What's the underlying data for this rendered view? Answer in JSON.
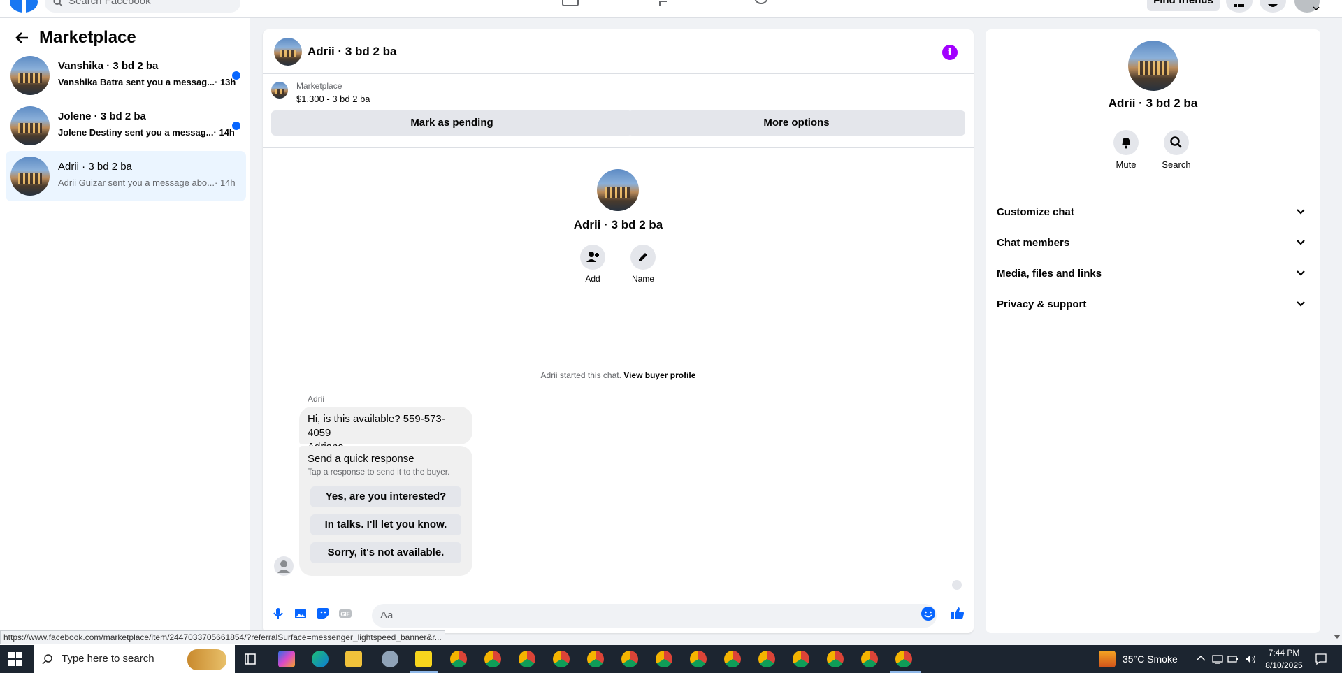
{
  "topbar": {
    "search_placeholder": "Search Facebook",
    "find_friends": "Find friends"
  },
  "sidebar": {
    "title": "Marketplace",
    "conversations": [
      {
        "title": "Vanshika · 3 bd 2 ba",
        "preview": "Vanshika Batra sent you a messag...",
        "time": "· 13h",
        "unread": true
      },
      {
        "title": "Jolene · 3 bd 2 ba",
        "preview": "Jolene Destiny sent you a messag...",
        "time": "· 14h",
        "unread": true
      },
      {
        "title": "Adrii · 3 bd 2 ba",
        "preview": "Adrii Guizar sent you a message abo...",
        "time": "· 14h",
        "unread": false
      }
    ]
  },
  "chat": {
    "header_name": "Adrii · 3 bd 2 ba",
    "listing_source": "Marketplace",
    "listing_price": "$1,300 - 3 bd 2 ba",
    "mark_pending": "Mark as pending",
    "more_options": "More options",
    "profile_name": "Adrii · 3 bd 2 ba",
    "add_label": "Add",
    "name_label": "Name",
    "started_text": "Adrii started this chat.",
    "view_buyer": "View buyer profile",
    "sender": "Adrii",
    "message_line1": "Hi, is this available? 559-573-4059",
    "message_line2": "Adriana",
    "quick_title": "Send a quick response",
    "quick_sub": "Tap a response to send it to the buyer.",
    "quick_responses": [
      "Yes, are you interested?",
      "In talks. I'll let you know.",
      "Sorry, it's not available."
    ],
    "input_placeholder": "Aa"
  },
  "right_panel": {
    "name": "Adrii · 3 bd 2 ba",
    "mute": "Mute",
    "search": "Search",
    "sections": [
      "Customize chat",
      "Chat members",
      "Media, files and links",
      "Privacy & support"
    ]
  },
  "status_url": "https://www.facebook.com/marketplace/item/2447033705661854/?referralSurface=messenger_lightspeed_banner&r...",
  "taskbar": {
    "search_text": "Type here to search",
    "weather": "35°C  Smoke",
    "time": "7:44 PM",
    "date": "8/10/2025"
  },
  "colors": {
    "accent_blue": "#0866ff",
    "info_purple": "#a200ff",
    "selected_bg": "#ebf5ff"
  }
}
